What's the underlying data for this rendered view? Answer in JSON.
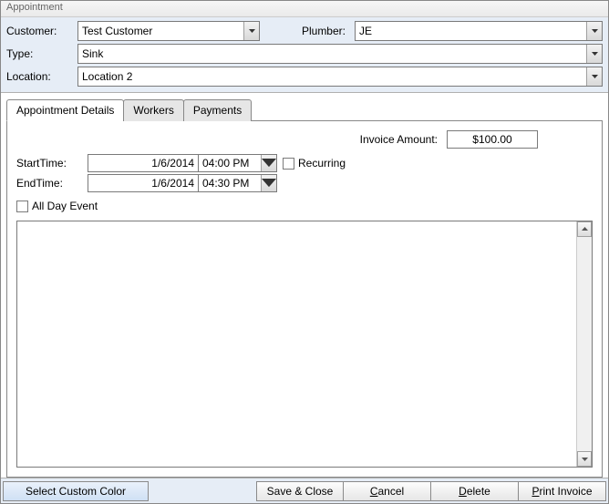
{
  "window": {
    "title": "Appointment"
  },
  "header": {
    "customer_label": "Customer:",
    "customer_value": "Test Customer",
    "plumber_label": "Plumber:",
    "plumber_value": "JE",
    "type_label": "Type:",
    "type_value": "Sink",
    "location_label": "Location:",
    "location_value": "Location 2"
  },
  "tabs": {
    "details": "Appointment Details",
    "workers": "Workers",
    "payments": "Payments"
  },
  "details": {
    "invoice_label": "Invoice Amount:",
    "invoice_value": "$100.00",
    "start_label": "StartTime:",
    "start_date": "1/6/2014",
    "start_time": "04:00 PM",
    "end_label": "EndTime:",
    "end_date": "1/6/2014",
    "end_time": "04:30 PM",
    "recurring_label": "Recurring",
    "recurring_checked": false,
    "allday_label": "All Day Event",
    "allday_checked": false,
    "notes": ""
  },
  "footer": {
    "select_color": "Select Custom Color",
    "save_close": "Save & Close",
    "cancel_rest": "ancel",
    "delete_rest": "elete",
    "print_rest": "rint Invoice"
  }
}
